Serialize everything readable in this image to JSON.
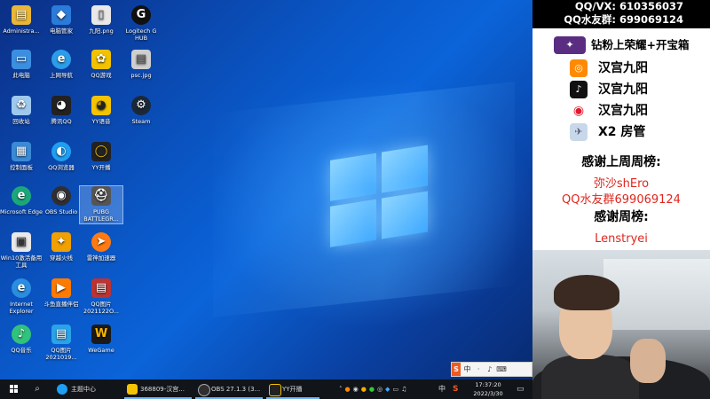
{
  "desktop": {
    "icons": [
      {
        "label": "Administra...",
        "icon": "user-folder-icon",
        "color": "#e8b73a"
      },
      {
        "label": "电脑管家",
        "icon": "shield-icon",
        "color": "#2b7bd9"
      },
      {
        "label": "九阳.png",
        "icon": "image-file-icon",
        "color": "#e8e8e8"
      },
      {
        "label": "Logitech G HUB",
        "icon": "logitech-icon",
        "color": "#111111"
      },
      {
        "label": "此电脑",
        "icon": "computer-icon",
        "color": "#3c8fe0"
      },
      {
        "label": "上网导航",
        "icon": "browser-icon",
        "color": "#2c9de8"
      },
      {
        "label": "QQ游戏",
        "icon": "qq-game-icon",
        "color": "#f2c200"
      },
      {
        "label": "psc.jpg",
        "icon": "image-file-icon",
        "color": "#cfcfcf"
      },
      {
        "label": "回收站",
        "icon": "recycle-bin-icon",
        "color": "#9ec9ef"
      },
      {
        "label": "腾讯QQ",
        "icon": "qq-icon",
        "color": "#222222"
      },
      {
        "label": "YY语音",
        "icon": "yy-voice-icon",
        "color": "#f4c400"
      },
      {
        "label": "Steam",
        "icon": "steam-icon",
        "color": "#1b2838"
      },
      {
        "label": "控制面板",
        "icon": "control-panel-icon",
        "color": "#3a8ad6"
      },
      {
        "label": "QQ浏览器",
        "icon": "qq-browser-icon",
        "color": "#1e9ff2"
      },
      {
        "label": "YY开播",
        "icon": "yy-live-icon",
        "color": "#222222"
      },
      {
        "label": "Microsoft Edge",
        "icon": "edge-icon",
        "color": "#1aa87a"
      },
      {
        "label": "OBS Studio",
        "icon": "obs-icon",
        "color": "#302e31"
      },
      {
        "label": "PUBG BATTLEGR...",
        "icon": "pubg-icon",
        "color": "#555555"
      },
      {
        "label": "Win10激活备用工具",
        "icon": "tool-icon",
        "color": "#e9e9e9"
      },
      {
        "label": "穿越火线",
        "icon": "crossfire-icon",
        "color": "#f0a000"
      },
      {
        "label": "雷神加速器",
        "icon": "thunder-accelerator-icon",
        "color": "#ff7a10"
      },
      {
        "label": "Internet Explorer",
        "icon": "ie-icon",
        "color": "#2a8ee0"
      },
      {
        "label": "斗鱼直播伴侣",
        "icon": "douyu-icon",
        "color": "#ff7a00"
      },
      {
        "label": "QQ图片 2021122O...",
        "icon": "image-file-icon",
        "color": "#b33"
      },
      {
        "label": "QQ音乐",
        "icon": "qq-music-icon",
        "color": "#31c27c"
      },
      {
        "label": "QQ图片 2021019...",
        "icon": "image-file-icon",
        "color": "#2aa3e8"
      },
      {
        "label": "WeGame",
        "icon": "wegame-icon",
        "color": "#1a1a1a"
      }
    ]
  },
  "taskbar": {
    "search_label": "主题中心",
    "apps": [
      {
        "label": "368809-汉宫...",
        "icon": "yy-voice-icon"
      },
      {
        "label": "OBS 27.1.3 (3...",
        "icon": "obs-icon"
      },
      {
        "label": "YY开播",
        "icon": "yy-live-icon"
      }
    ],
    "tray_lang": "中",
    "time": "17:37:20",
    "date": "2022/3/30"
  },
  "ime": {
    "items": [
      "S",
      "中",
      "·",
      "♪",
      "⌨"
    ]
  },
  "panel": {
    "banner_line1": "QQ/VX: 610356037",
    "banner_line2": "QQ水友群: 699069124",
    "promos": [
      {
        "text": "钻粉上荣耀+开宝箱",
        "icon": "badge-icon",
        "color": "#5a2d82"
      },
      {
        "text": "汉宫九阳",
        "icon": "kuaishou-icon",
        "color": "#ff8a00"
      },
      {
        "text": "汉宫九阳",
        "icon": "tiktok-icon",
        "color": "#111111"
      },
      {
        "text": "汉宫九阳",
        "icon": "weibo-icon",
        "color": "#e6162d"
      },
      {
        "text": "X2 房管",
        "icon": "jet-icon",
        "color": "#8aa8c8"
      }
    ],
    "thanks_last_week": "感谢上周周榜:",
    "last_week_names": [
      "弥沙shEro",
      "QQ水友群699069124"
    ],
    "thanks_week": "感谢周榜:",
    "week_names": [
      "Lenstryei"
    ]
  }
}
